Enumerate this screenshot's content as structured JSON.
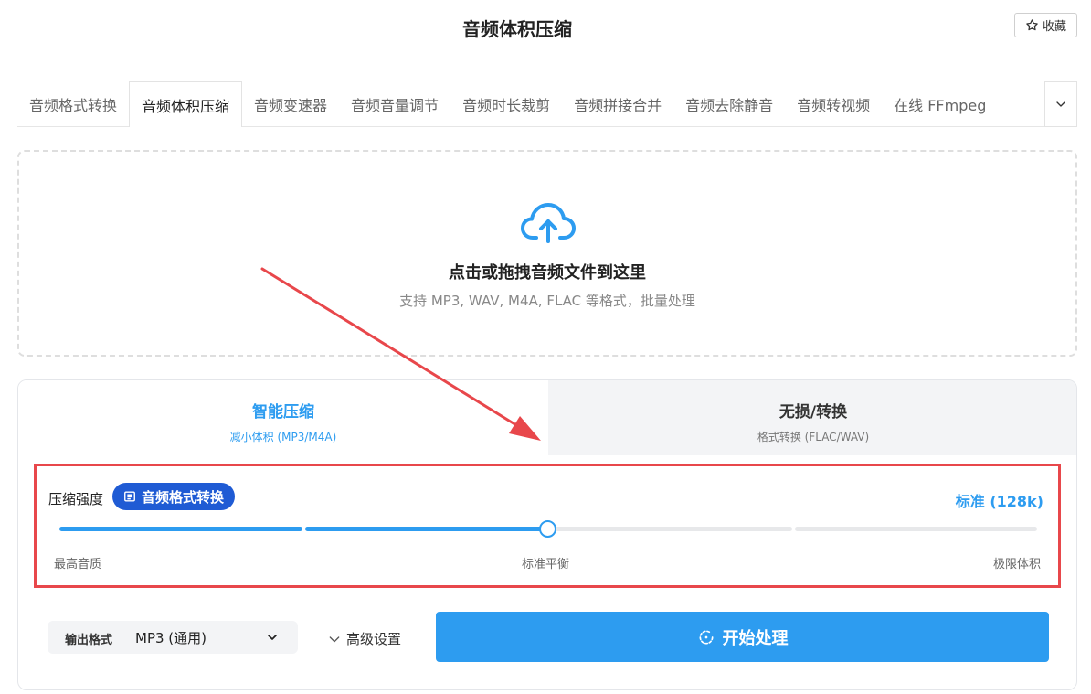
{
  "header": {
    "title": "音频体积压缩",
    "favorite_label": "收藏"
  },
  "tabs": [
    {
      "label": "音频格式转换"
    },
    {
      "label": "音频体积压缩"
    },
    {
      "label": "音频变速器"
    },
    {
      "label": "音频音量调节"
    },
    {
      "label": "音频时长裁剪"
    },
    {
      "label": "音频拼接合并"
    },
    {
      "label": "音频去除静音"
    },
    {
      "label": "音频转视频"
    },
    {
      "label": "在线 FFmpeg"
    }
  ],
  "dropzone": {
    "title": "点击或拖拽音频文件到这里",
    "subtitle": "支持 MP3, WAV, M4A, FLAC 等格式，批量处理"
  },
  "modes": {
    "smart": {
      "title": "智能压缩",
      "subtitle": "减小体积 (MP3/M4A)"
    },
    "lossless": {
      "title": "无损/转换",
      "subtitle": "格式转换 (FLAC/WAV)"
    }
  },
  "strength": {
    "label": "压缩强度",
    "badge": "音频格式转换",
    "value_label": "标准 (128k)",
    "level_fraction": 0.5,
    "ticks": [
      "最高音质",
      "标准平衡",
      "极限体积"
    ]
  },
  "output": {
    "label": "输出格式",
    "value": "MP3 (通用)"
  },
  "advanced_label": "高级设置",
  "start_label": "开始处理",
  "colors": {
    "accent": "#2d9cf0",
    "badge": "#1f5bd4",
    "annotation": "#e8474b"
  }
}
